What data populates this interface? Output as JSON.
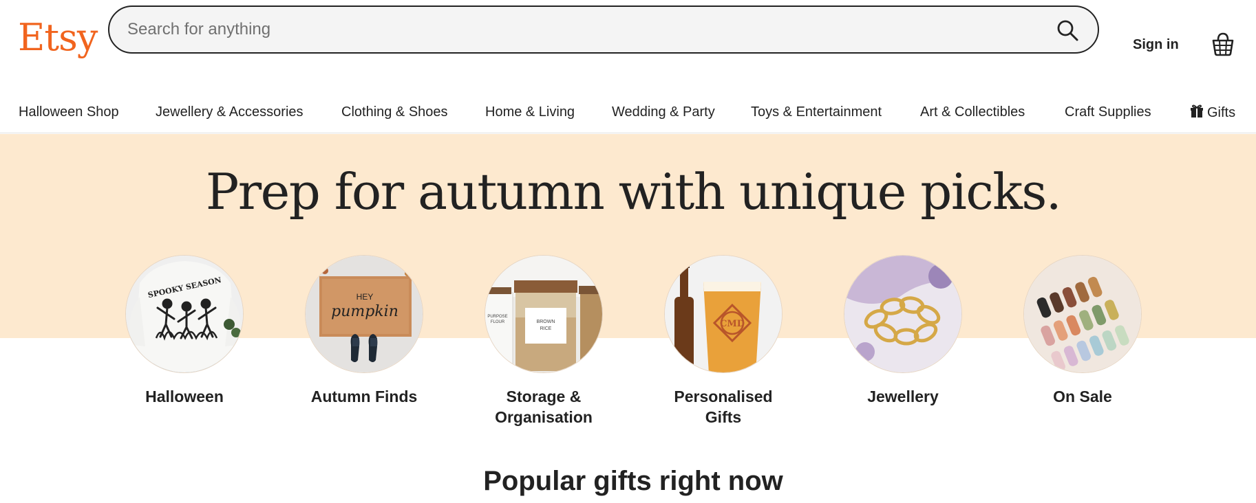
{
  "header": {
    "logo": "Etsy",
    "search_placeholder": "Search for anything",
    "sign_in": "Sign in",
    "search_icon": "search-icon",
    "cart_icon": "basket-icon"
  },
  "nav": {
    "items": [
      "Halloween Shop",
      "Jewellery & Accessories",
      "Clothing & Shoes",
      "Home & Living",
      "Wedding & Party",
      "Toys & Entertainment",
      "Art & Collectibles",
      "Craft Supplies",
      "Gifts"
    ],
    "gifts_icon": "gift-icon"
  },
  "hero": {
    "title": "Prep for autumn with unique picks.",
    "background": "#fde9cf",
    "categories": [
      {
        "line1": "Halloween",
        "line2": ""
      },
      {
        "line1": "Autumn Finds",
        "line2": ""
      },
      {
        "line1": "Storage &",
        "line2": "Organisation"
      },
      {
        "line1": "Personalised",
        "line2": "Gifts"
      },
      {
        "line1": "Jewellery",
        "line2": ""
      },
      {
        "line1": "On Sale",
        "line2": ""
      }
    ],
    "images": {
      "halloween": {
        "shirt_text": "SPOOKY SEASON"
      },
      "autumn": {
        "mat_text_1": "HEY",
        "mat_text_2": "pumpkin"
      },
      "storage": {
        "label_1": "PURPOSE",
        "label_2": "FLOUR",
        "label_3": "BROWN",
        "label_4": "RICE"
      },
      "gifts": {
        "monogram": "CMD"
      }
    }
  },
  "sections": {
    "popular_title": "Popular gifts right now"
  },
  "colors": {
    "brand": "#f1641e",
    "text": "#222222",
    "hero_bg": "#fde9cf"
  }
}
